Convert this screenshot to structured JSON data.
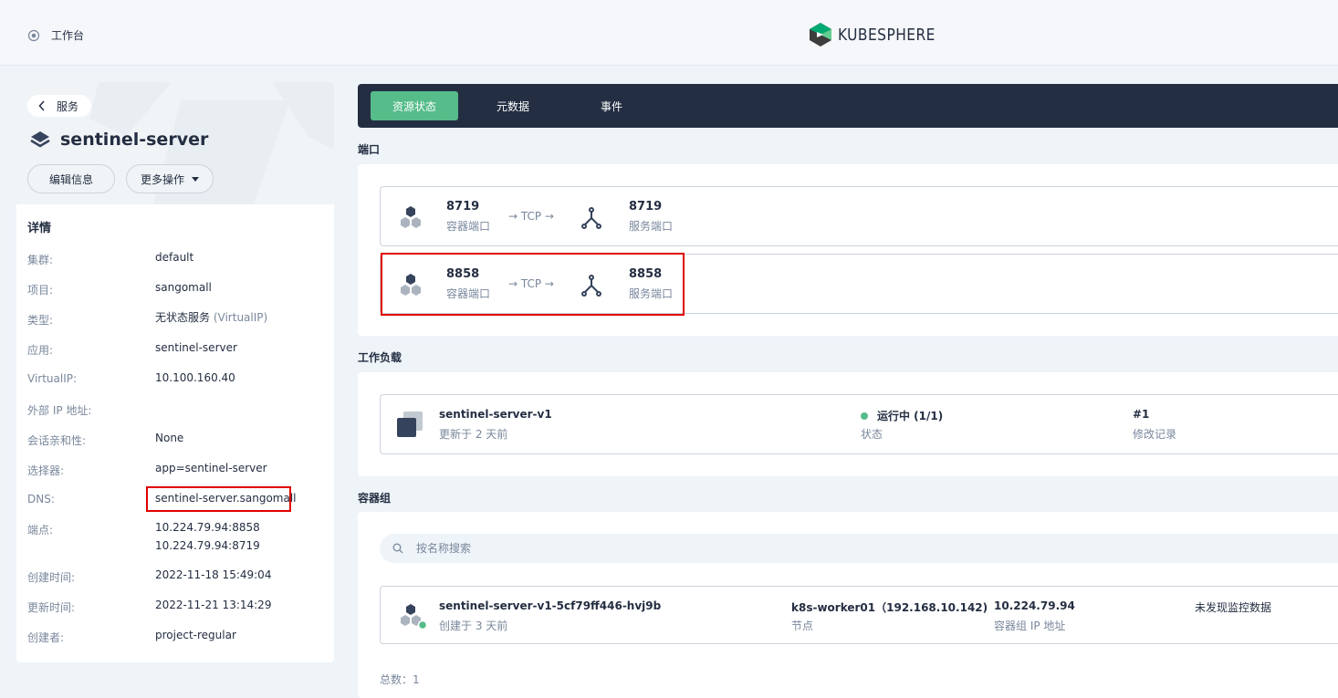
{
  "topbar": {
    "workbench_label": "工作台",
    "logo_text": "KUBESPHERE"
  },
  "left": {
    "back_label": "服务",
    "service_name": "sentinel-server",
    "edit_button": "编辑信息",
    "more_button": "更多操作",
    "details_title": "详情",
    "details": [
      {
        "key": "集群:",
        "value": "default"
      },
      {
        "key": "项目:",
        "value": "sangomall"
      },
      {
        "key": "类型:",
        "value": "无状态服务",
        "value_extra": "(VirtualIP)"
      },
      {
        "key": "应用:",
        "value": "sentinel-server"
      },
      {
        "key": "VirtualIP:",
        "value": "10.100.160.40"
      },
      {
        "key": "外部 IP 地址:",
        "value": ""
      },
      {
        "key": "会话亲和性:",
        "value": "None"
      },
      {
        "key": "选择器:",
        "value": "app=sentinel-server"
      },
      {
        "key": "DNS:",
        "value": "sentinel-server.sangomall"
      },
      {
        "key": "端点:",
        "value": "10.224.79.94:8858",
        "value_line2": "10.224.79.94:8719"
      },
      {
        "key": "创建时间:",
        "value": "2022-11-18 15:49:04"
      },
      {
        "key": "更新时间:",
        "value": "2022-11-21 13:14:29"
      },
      {
        "key": "创建者:",
        "value": "project-regular"
      }
    ]
  },
  "tabs": [
    "资源状态",
    "元数据",
    "事件"
  ],
  "ports": {
    "section_label": "端口",
    "items": [
      {
        "container_port": "8719",
        "container_label": "容器端口",
        "protocol": "→ TCP →",
        "service_port": "8719",
        "service_label": "服务端口"
      },
      {
        "container_port": "8858",
        "container_label": "容器端口",
        "protocol": "→ TCP →",
        "service_port": "8858",
        "service_label": "服务端口"
      }
    ]
  },
  "workload": {
    "section_label": "工作负载",
    "name": "sentinel-server-v1",
    "updated": "更新于 2 天前",
    "status": "运行中 (1/1)",
    "status_label": "状态",
    "revision": "#1",
    "revision_label": "修改记录",
    "status_color": "#55bc8a"
  },
  "pods": {
    "section_label": "容器组",
    "search_placeholder": "按名称搜索",
    "name": "sentinel-server-v1-5cf79ff446-hvj9b",
    "created": "创建于 3 天前",
    "node": "k8s-worker01（192.168.10.142)",
    "node_label": "节点",
    "pod_ip": "10.224.79.94",
    "pod_ip_label": "容器组 IP 地址",
    "monitor": "未发现监控数据",
    "total": "总数：1"
  },
  "colors": {
    "accent": "#55bc8a",
    "dark": "#242e42",
    "highlight": "#e00000"
  }
}
